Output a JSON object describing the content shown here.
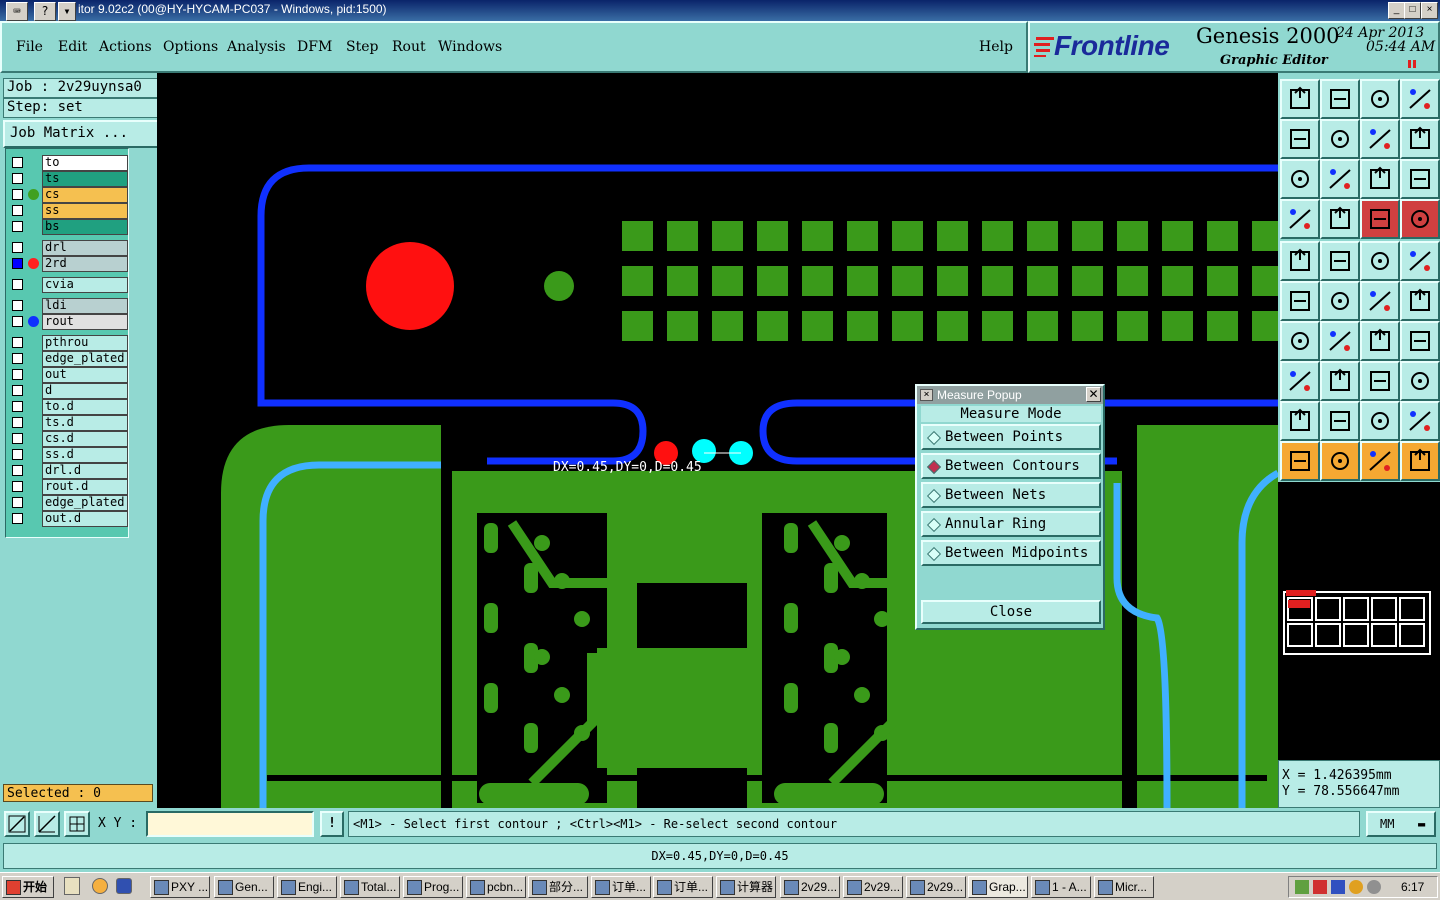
{
  "window": {
    "title": "itor 9.02c2 (00@HY-HYCAM-PC037 - Windows, pid:1500)",
    "sys_icons": [
      "keyboard-icon",
      "help-icon",
      "menu-arrow-icon"
    ],
    "controls": [
      "_",
      "□",
      "×"
    ]
  },
  "menu": {
    "items": [
      "File",
      "Edit",
      "Actions",
      "Options",
      "Analysis",
      "DFM",
      "Step",
      "Rout",
      "Windows"
    ],
    "help": "Help"
  },
  "brand": {
    "logo": "Frontline",
    "product": "Genesis 2000",
    "subtitle": "Graphic Editor",
    "date": "24 Apr 2013",
    "time": "05:44 AM"
  },
  "job": {
    "job_label": "Job : 2v29uynsa0",
    "step_label": "Step: set",
    "matrix_button": "Job Matrix ..."
  },
  "layers": [
    {
      "name": "to",
      "color": "#ffffff",
      "checked": false,
      "dot": ""
    },
    {
      "name": "ts",
      "color": "#20a080",
      "checked": false,
      "dot": ""
    },
    {
      "name": "cs",
      "color": "#f5c050",
      "checked": false,
      "dot": "#40a020"
    },
    {
      "name": "ss",
      "color": "#f5c050",
      "checked": false,
      "dot": ""
    },
    {
      "name": "bs",
      "color": "#20a080",
      "checked": false,
      "dot": ""
    },
    {
      "name": "drl",
      "color": "#b8d0d0",
      "checked": false,
      "dot": ""
    },
    {
      "name": "2rd",
      "color": "#b8d0d0",
      "checked": true,
      "dot": "#ff2020"
    },
    {
      "name": "cvia",
      "color": "#b8ece6",
      "checked": false,
      "dot": ""
    },
    {
      "name": "ldi",
      "color": "#b8d0d0",
      "checked": false,
      "dot": ""
    },
    {
      "name": "rout",
      "color": "#e0e0e0",
      "checked": false,
      "dot": "#1030ff"
    },
    {
      "name": "pthrou",
      "color": "#b8ece6",
      "checked": false,
      "dot": ""
    },
    {
      "name": "edge_plated",
      "color": "#b8ece6",
      "checked": false,
      "dot": ""
    },
    {
      "name": "out",
      "color": "#b8ece6",
      "checked": false,
      "dot": ""
    },
    {
      "name": "d",
      "color": "#b8ece6",
      "checked": false,
      "dot": ""
    },
    {
      "name": "to.d",
      "color": "#b8ece6",
      "checked": false,
      "dot": ""
    },
    {
      "name": "ts.d",
      "color": "#b8ece6",
      "checked": false,
      "dot": ""
    },
    {
      "name": "cs.d",
      "color": "#b8ece6",
      "checked": false,
      "dot": ""
    },
    {
      "name": "ss.d",
      "color": "#b8ece6",
      "checked": false,
      "dot": ""
    },
    {
      "name": "drl.d",
      "color": "#b8ece6",
      "checked": false,
      "dot": ""
    },
    {
      "name": "rout.d",
      "color": "#b8ece6",
      "checked": false,
      "dot": ""
    },
    {
      "name": "edge_plated",
      "color": "#b8ece6",
      "checked": false,
      "dot": ""
    },
    {
      "name": "out.d",
      "color": "#b8ece6",
      "checked": false,
      "dot": ""
    }
  ],
  "selected": "Selected : 0",
  "canvas": {
    "measure_label": "DX=0.45,DY=0,D=0.45",
    "colors": {
      "copper": "#3a9a1a",
      "rout": "#1030ff",
      "edge": "#40b0ff",
      "drill": "#ff1010",
      "cursor": "#00ffff"
    }
  },
  "popup": {
    "title": "Measure Popup",
    "mode_label": "Measure Mode",
    "options": [
      {
        "label": "Between Points",
        "selected": false
      },
      {
        "label": "Between Contours",
        "selected": true
      },
      {
        "label": "Between Nets",
        "selected": false
      },
      {
        "label": "Annular Ring",
        "selected": false
      },
      {
        "label": "Between Midpoints",
        "selected": false
      }
    ],
    "close": "Close"
  },
  "coords": {
    "x": "X = 1.426395mm",
    "y": "Y = 78.556647mm"
  },
  "command": {
    "xy_label": "X Y :",
    "xy_value": "",
    "prompt": "<M1> - Select first contour ; <Ctrl><M1> - Re-select second contour",
    "units": "MM"
  },
  "status": "DX=0.45,DY=0,D=0.45",
  "taskbar": {
    "start": "开始",
    "tasks": [
      "PXY ...",
      "Gen...",
      "Engi...",
      "Total...",
      "Prog...",
      "pcbn...",
      "部分...",
      "订单...",
      "订单...",
      "计算器",
      "2v29...",
      "2v29...",
      "2v29...",
      "Grap...",
      "1 - A...",
      "Micr..."
    ],
    "clock": "6:17"
  }
}
